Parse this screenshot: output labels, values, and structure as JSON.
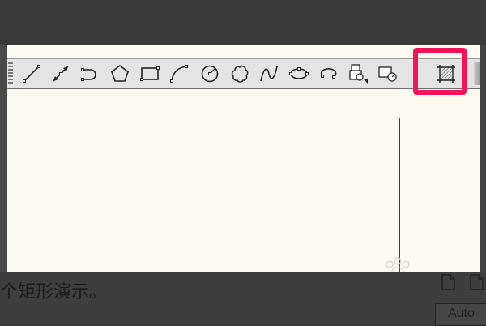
{
  "background": {
    "caption": "个矩形演示。",
    "auto_label": "Auto"
  },
  "toolbar": {
    "tools": [
      {
        "name": "line-tool-icon"
      },
      {
        "name": "construction-line-tool-icon"
      },
      {
        "name": "polyline-tool-icon"
      },
      {
        "name": "polygon-tool-icon"
      },
      {
        "name": "rectangle-tool-icon"
      },
      {
        "name": "arc-tool-icon"
      },
      {
        "name": "circle-tool-icon"
      },
      {
        "name": "revision-cloud-tool-icon"
      },
      {
        "name": "spline-tool-icon"
      },
      {
        "name": "ellipse-tool-icon"
      },
      {
        "name": "ellipse-arc-tool-icon"
      },
      {
        "name": "insert-block-tool-icon"
      },
      {
        "name": "make-block-tool-icon"
      },
      {
        "name": "hatch-tool-icon"
      }
    ],
    "highlighted_tool": "hatch-tool-icon"
  },
  "colors": {
    "highlight": "#f5145b",
    "drawing_line": "#2c2ccc",
    "canvas": "#fdfaf0",
    "toolbar": "#e4e4e4"
  }
}
